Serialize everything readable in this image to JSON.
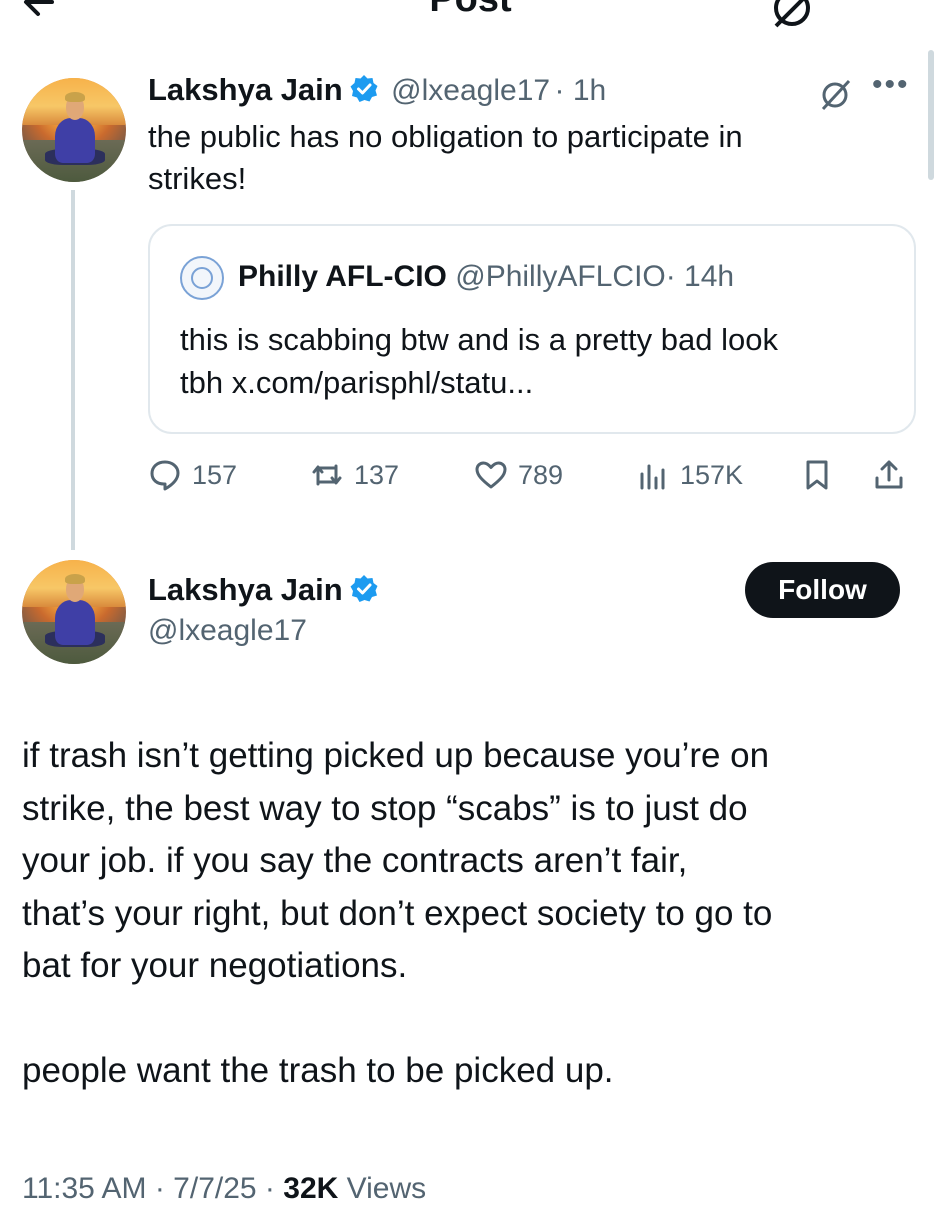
{
  "header": {
    "title": "Post"
  },
  "reply_post": {
    "author_name": "Lakshya Jain",
    "handle": "@lxeagle17",
    "time": "· 1h",
    "text_line1": "the public has no obligation to participate in",
    "text_line2": "strikes!",
    "quoted": {
      "author_name": "Philly AFL-CIO",
      "handle": "@PhillyAFLCIO",
      "time": "· 14h",
      "text_line1": "this is scabbing btw and is a pretty bad look",
      "text_line2": "tbh x.com/parisphl/statu..."
    },
    "stats": {
      "replies": "157",
      "reposts": "137",
      "likes": "789",
      "views": "157K"
    }
  },
  "main_post": {
    "author_name": "Lakshya Jain",
    "handle": "@lxeagle17",
    "follow_label": "Follow",
    "paragraph1_lines": [
      "if trash isn’t getting picked up because you’re on",
      "strike, the best way to stop “scabs” is to just do",
      "your job. if you say the contracts aren’t fair,",
      "that’s your right, but don’t expect society to go to",
      "bat for your negotiations."
    ],
    "paragraph2": "people want the trash to be picked up.",
    "footer": {
      "time": "11:35 AM · 7/7/25 · ",
      "views_count": "32K",
      "views_label": " Views"
    }
  },
  "colors": {
    "verified": "#1d9bf0",
    "text": "#0f1419",
    "muted": "#536471",
    "border": "#e1e8ed"
  },
  "icons": [
    "back-arrow-icon",
    "grok-icon",
    "more-icon",
    "verified-badge-icon",
    "reply-icon",
    "repost-icon",
    "like-icon",
    "views-icon",
    "bookmark-icon",
    "share-icon"
  ]
}
